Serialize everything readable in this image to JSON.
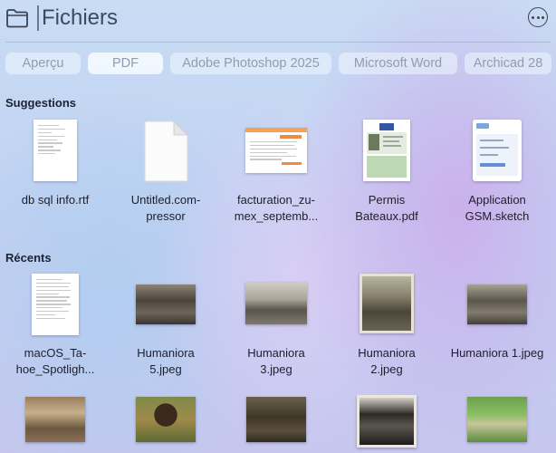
{
  "search": {
    "placeholder": "Fichiers",
    "value": ""
  },
  "header": {
    "more_icon": "ellipsis-circle-icon",
    "folder_icon": "folder-icon"
  },
  "filters": [
    "Aperçu",
    "PDF",
    "Adobe Photoshop 2025",
    "Microsoft Word",
    "Archicad 28"
  ],
  "suggestions": {
    "title": "Suggestions",
    "items": [
      {
        "label_1": "db sql info.rtf",
        "label_2": "",
        "thumb": "text-document"
      },
      {
        "label_1": "Untitled.com-",
        "label_2": "pressor",
        "thumb": "blank-file-icon"
      },
      {
        "label_1": "facturation_zu-",
        "label_2": "mex_septemb...",
        "thumb": "invoice-spreadsheet"
      },
      {
        "label_1": "Permis",
        "label_2": "Bateaux.pdf",
        "thumb": "license-card"
      },
      {
        "label_1": "Application",
        "label_2": "GSM.sketch",
        "thumb": "mobile-app-mockup"
      }
    ]
  },
  "recents": {
    "title": "Récents",
    "items": [
      {
        "label_1": "macOS_Ta-",
        "label_2": "hoe_Spotligh...",
        "thumb": "text-document"
      },
      {
        "label_1": "Humaniora",
        "label_2": "5.jpeg",
        "thumb": "sepia-photo"
      },
      {
        "label_1": "Humaniora",
        "label_2": "3.jpeg",
        "thumb": "classroom-photo"
      },
      {
        "label_1": "Humaniora",
        "label_2": "2.jpeg",
        "thumb": "group-photo"
      },
      {
        "label_1": "Humaniora 1.jpeg",
        "label_2": "",
        "thumb": "sepia-photo"
      }
    ],
    "more_thumbs": [
      "sepia-photo",
      "portrait-photo",
      "sepia-photo",
      "group-photo",
      "park-photo"
    ]
  }
}
